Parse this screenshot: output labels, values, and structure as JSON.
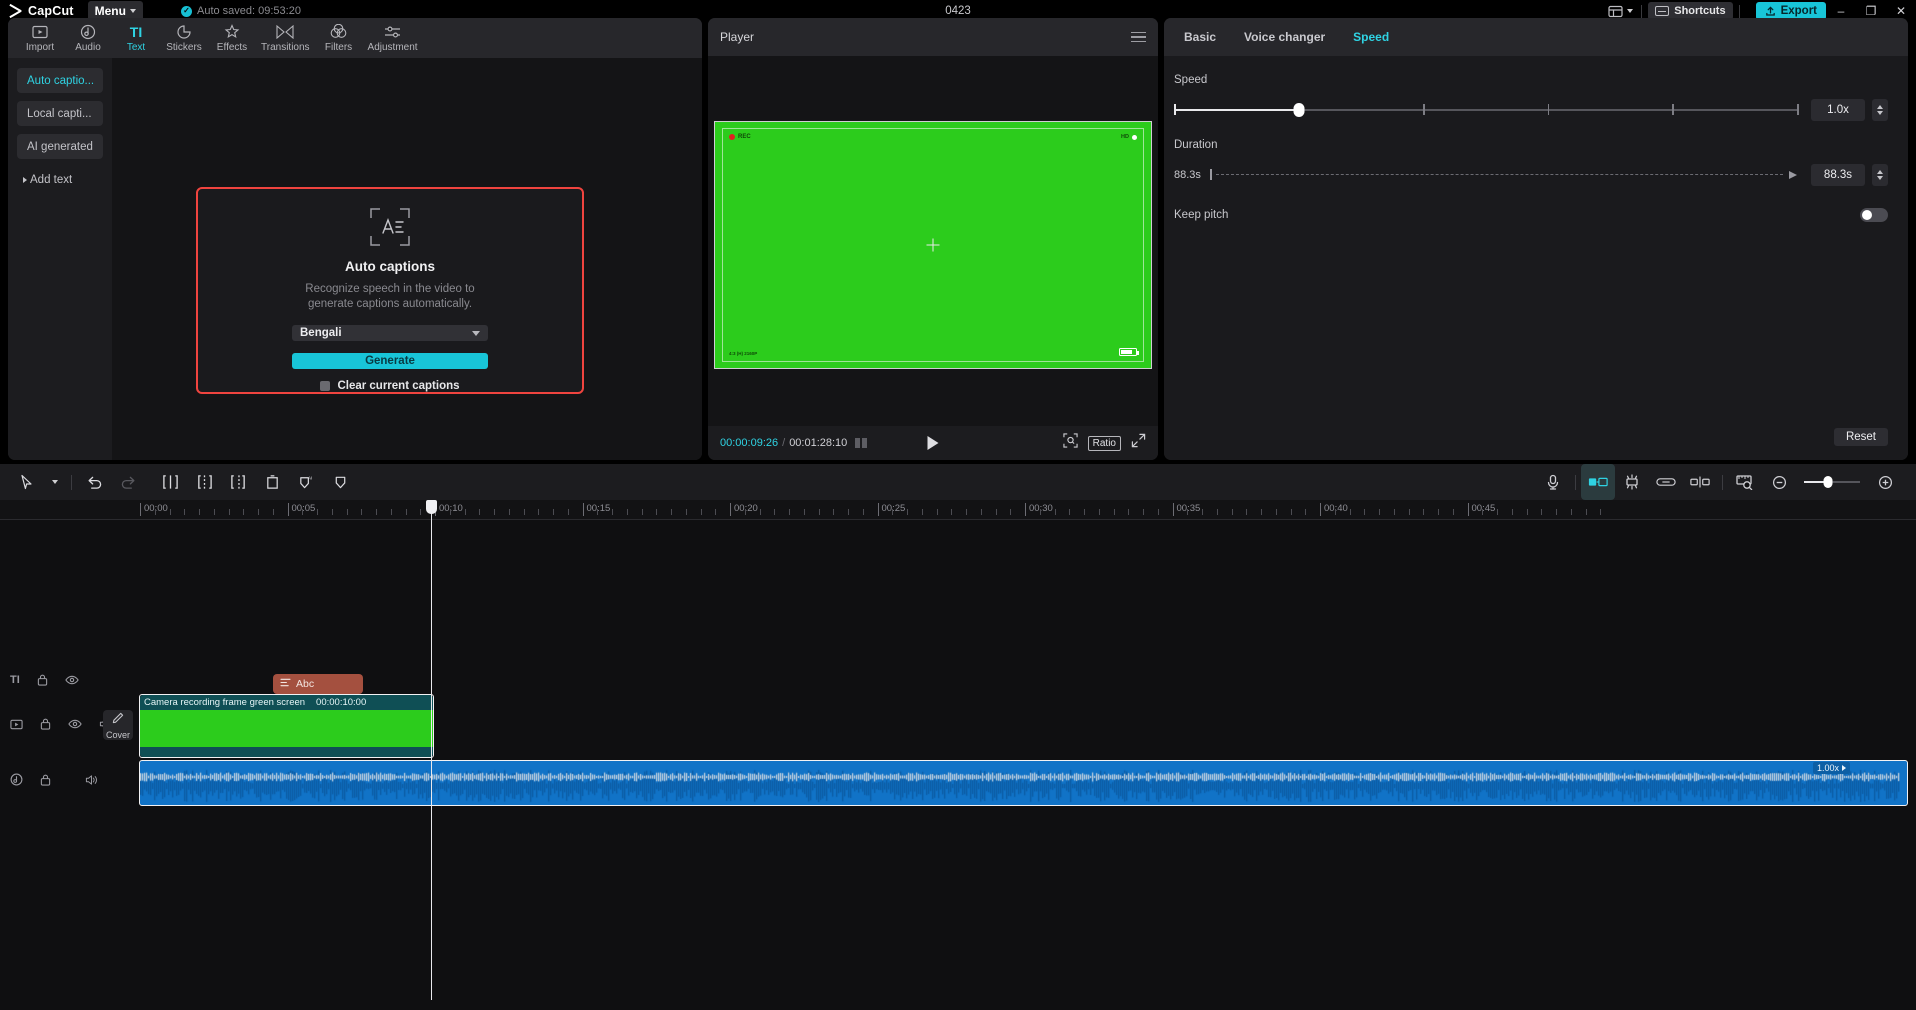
{
  "titlebar": {
    "brand": "CapCut",
    "menu_label": "Menu",
    "autosave_text": "Auto saved: 09:53:20",
    "project_name": "0423",
    "shortcuts_label": "Shortcuts",
    "export_label": "Export",
    "minimize": "–",
    "maximize": "❐",
    "close": "✕"
  },
  "left_panel": {
    "tabs": [
      {
        "label": "Import",
        "icon": "import-icon",
        "active": false
      },
      {
        "label": "Audio",
        "icon": "audio-icon",
        "active": false
      },
      {
        "label": "Text",
        "icon": "text-icon",
        "active": true
      },
      {
        "label": "Stickers",
        "icon": "stickers-icon",
        "active": false
      },
      {
        "label": "Effects",
        "icon": "effects-icon",
        "active": false
      },
      {
        "label": "Transitions",
        "icon": "transitions-icon",
        "active": false
      },
      {
        "label": "Filters",
        "icon": "filters-icon",
        "active": false
      },
      {
        "label": "Adjustment",
        "icon": "adjustment-icon",
        "active": false
      }
    ],
    "subnav": [
      {
        "label": "Auto captio...",
        "active": true
      },
      {
        "label": "Local capti...",
        "active": false
      },
      {
        "label": "AI generated",
        "active": false
      },
      {
        "label": "Add text",
        "active": false
      }
    ],
    "auto_captions": {
      "title": "Auto captions",
      "description": "Recognize speech in the video to generate captions automatically.",
      "language": "Bengali",
      "generate_label": "Generate",
      "clear_label": "Clear current captions",
      "highlight_color": "#f0443f",
      "accent_color": "#18c5d8"
    }
  },
  "player": {
    "title": "Player",
    "current_time": "00:00:09:26",
    "separator": "/",
    "total_time": "00:01:28:10",
    "ratio_label": "Ratio",
    "preview": {
      "rec_label": "REC",
      "hd_label": "HD",
      "resolution_label": "4:3 (H)\n2160P",
      "background_color": "#2ccc1c"
    }
  },
  "right_panel": {
    "tabs": [
      {
        "label": "Basic",
        "active": false
      },
      {
        "label": "Voice changer",
        "active": false
      },
      {
        "label": "Speed",
        "active": true
      }
    ],
    "speed_label": "Speed",
    "speed_value": "1.0x",
    "duration_label": "Duration",
    "duration_start": "88.3s",
    "duration_value": "88.3s",
    "keep_pitch_label": "Keep pitch",
    "keep_pitch_on": false,
    "reset_label": "Reset"
  },
  "timeline": {
    "toolbar": [
      {
        "name": "select-tool",
        "icon": "cursor-icon"
      },
      {
        "name": "tool-dropdown",
        "icon": "chevron-down-icon"
      },
      {
        "name": "undo-button",
        "icon": "undo-icon"
      },
      {
        "name": "redo-button",
        "icon": "redo-icon"
      },
      {
        "name": "split-button",
        "icon": "split-icon"
      },
      {
        "name": "trim-left-button",
        "icon": "trim-left-icon"
      },
      {
        "name": "trim-right-button",
        "icon": "trim-right-icon"
      },
      {
        "name": "delete-button",
        "icon": "trash-icon"
      },
      {
        "name": "ai-mask-button",
        "icon": "ai-shield-icon"
      },
      {
        "name": "mask-button",
        "icon": "shield-icon"
      }
    ],
    "toolbar_right": [
      {
        "name": "record-voiceover-button",
        "icon": "microphone-icon"
      },
      {
        "name": "auto-fill-button",
        "icon": "fill-icon"
      },
      {
        "name": "magnetic-button",
        "icon": "magnet-icon"
      },
      {
        "name": "link-button",
        "icon": "link-icon"
      },
      {
        "name": "snap-button",
        "icon": "snap-icon"
      },
      {
        "name": "adjust-width-button",
        "icon": "ruler-icon"
      },
      {
        "name": "zoom-out-button",
        "icon": "zoom-out-icon"
      },
      {
        "name": "zoom-in-button",
        "icon": "zoom-in-icon"
      }
    ],
    "ruler_labels": [
      "00:00",
      "00:05",
      "00:10",
      "00:15",
      "00:20",
      "00:25",
      "00:30",
      "00:35",
      "00:40",
      "00:45"
    ],
    "text_clip": {
      "label": "Abc",
      "icon": "caption-icon"
    },
    "video_clip": {
      "name": "Camera recording frame green screen",
      "duration": "00:00:10:00"
    },
    "cover_label": "Cover",
    "audio_clip": {
      "speed_badge": "1.00x"
    },
    "track_controls": [
      {
        "track": "text",
        "icons": [
          "text-track-icon",
          "lock-icon",
          "eye-icon",
          "mute-icon"
        ]
      },
      {
        "track": "video",
        "icons": [
          "video-track-icon",
          "lock-icon",
          "eye-icon",
          "volume-icon"
        ]
      },
      {
        "track": "audio",
        "icons": [
          "audio-track-icon",
          "lock-icon",
          "volume-icon"
        ]
      }
    ]
  }
}
